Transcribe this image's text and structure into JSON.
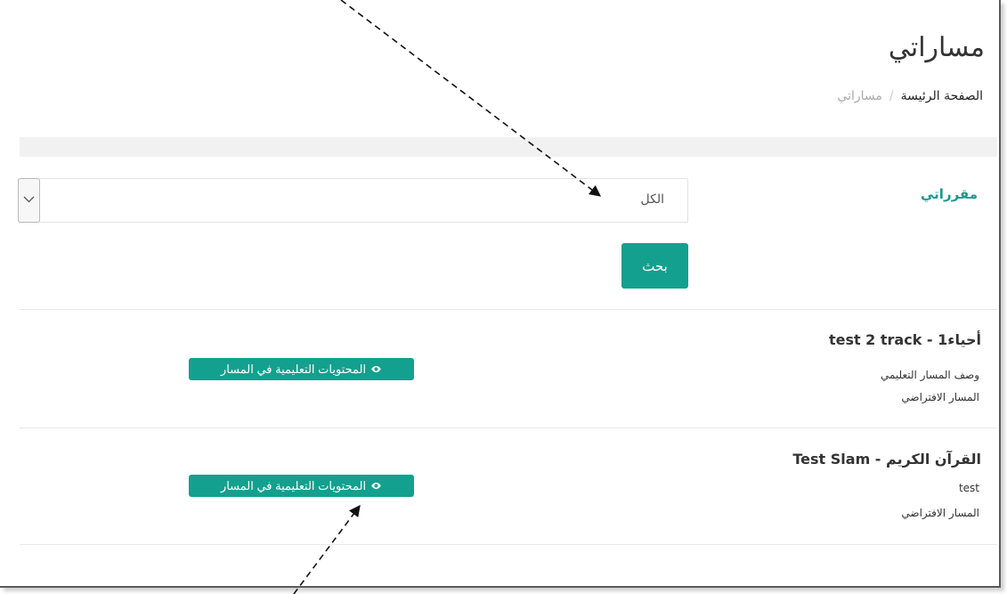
{
  "page": {
    "title": "مساراتي",
    "breadcrumb": {
      "home": "الصفحة الرئيسة",
      "separator": "/",
      "current": "مساراتي"
    }
  },
  "filter": {
    "label": "مقرراتي",
    "selected": "الكل",
    "search_label": "بحث"
  },
  "tracks": [
    {
      "title": "أحياء1 - test 2 track",
      "description": "وصف المسار التعليمي",
      "default": "المسار الافتراضي",
      "button_label": "المحتويات التعليمية في المسار"
    },
    {
      "title": "القرآن الكريم - Test Slam",
      "description": "test",
      "default": "المسار الافتراضي",
      "button_label": "المحتويات التعليمية في المسار"
    }
  ],
  "colors": {
    "accent": "#13a08e",
    "label": "#1a9b8a"
  },
  "icons": {
    "content_button": "eye-icon",
    "select": "chevron-down-icon"
  }
}
